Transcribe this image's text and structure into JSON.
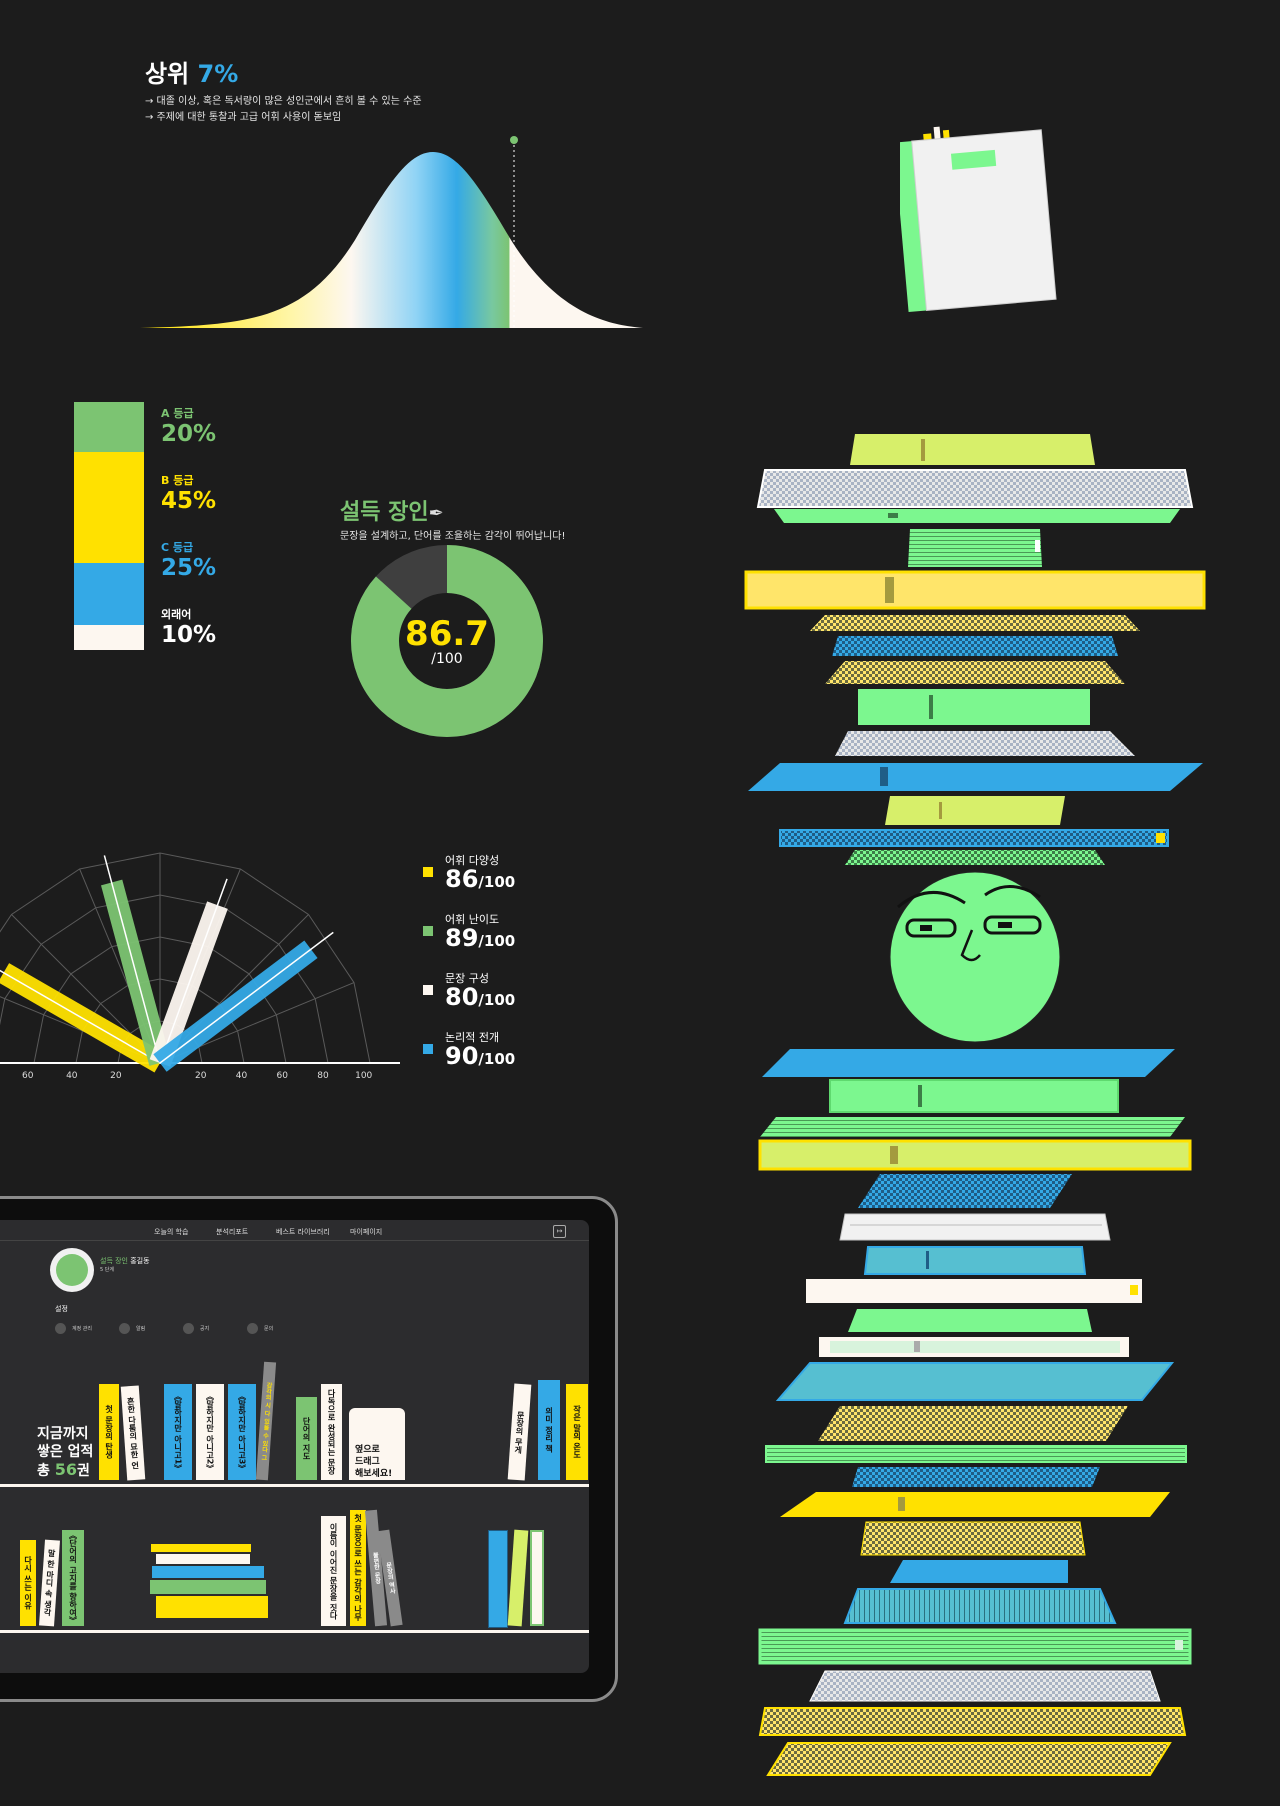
{
  "rank": {
    "prefix": "상위",
    "value": "7%",
    "notes": [
      "→ 대졸 이상, 혹은 독서량이 많은 성인군에서 흔히 볼 수 있는 수준",
      "→ 주제에 대한 통찰과 고급 어휘 사용이 돋보임"
    ],
    "percentile": 7
  },
  "grades": [
    {
      "label": "A 등급",
      "pct": "20%",
      "value": 20,
      "color": "#7cc472"
    },
    {
      "label": "B 등급",
      "pct": "45%",
      "value": 45,
      "color": "#ffe100"
    },
    {
      "label": "C 등급",
      "pct": "25%",
      "value": 25,
      "color": "#34a9e6"
    },
    {
      "label": "외래어",
      "pct": "10%",
      "value": 10,
      "color": "#fdf7f0"
    }
  ],
  "persuasion": {
    "title": "설득 장인",
    "subtitle": "문장을 설계하고, 단어를 조율하는 감각이 뛰어납니다!",
    "score": "86.7",
    "denominator": "/100",
    "value": 86.7,
    "color": "#7cc472"
  },
  "radar": {
    "ticks_left": [
      "60",
      "40",
      "20"
    ],
    "ticks_right": [
      "20",
      "40",
      "60",
      "80",
      "100"
    ],
    "items": [
      {
        "name": "어휘 다양성",
        "score": "86",
        "value": 86,
        "color": "#ffe100"
      },
      {
        "name": "어휘 난이도",
        "score": "89",
        "value": 89,
        "color": "#7cc472"
      },
      {
        "name": "문장 구성",
        "score": "80",
        "value": 80,
        "color": "#fdf7f0"
      },
      {
        "name": "논리적 전개",
        "score": "90",
        "value": 90,
        "color": "#34a9e6"
      }
    ],
    "denominator": "/100"
  },
  "tablet": {
    "nav": [
      "오늘의 학습",
      "분석리포트",
      "베스트 라이브러리",
      "마이페이지"
    ],
    "profile": {
      "badge": "설득 장인",
      "name": "홍길동",
      "level": "5 단계",
      "avatar_text": "설득 장인"
    },
    "settings_title": "설정",
    "settings": [
      "계정 관리",
      "알림",
      "공지",
      "문의"
    ],
    "achievement": {
      "line1": "지금까지",
      "line2": "쌓은 업적",
      "prefix": "총",
      "count": "56",
      "suffix": "권"
    },
    "drag_hint": [
      "옆으로",
      "드래그",
      "해보세요!"
    ],
    "shelf1": [
      "첫 문장의 탄생",
      "흔한 다툼의 묘한 언",
      "《말하지만 아니고1》",
      "《말하지만 아니고2》",
      "《말하지만 아니고3》",
      "감각의 시 다 있을 수 있다 그",
      "단어의 지도",
      "다독으로 완성되는 문장"
    ],
    "shelf1_right": [
      "문장의 무게",
      "의미 정리 책",
      "작은 말의 온도"
    ],
    "shelf2": [
      "다시 쓰는 이유",
      "말 한 마디 속 생각",
      "《단어의 고지를 향하여》"
    ],
    "shelf2_mid": [
      "이름이 이어진 문장을 짓다",
      "첫 문장으로 쓰는 감각의 나무",
      "불편한 문장",
      "문장의 역사"
    ]
  }
}
